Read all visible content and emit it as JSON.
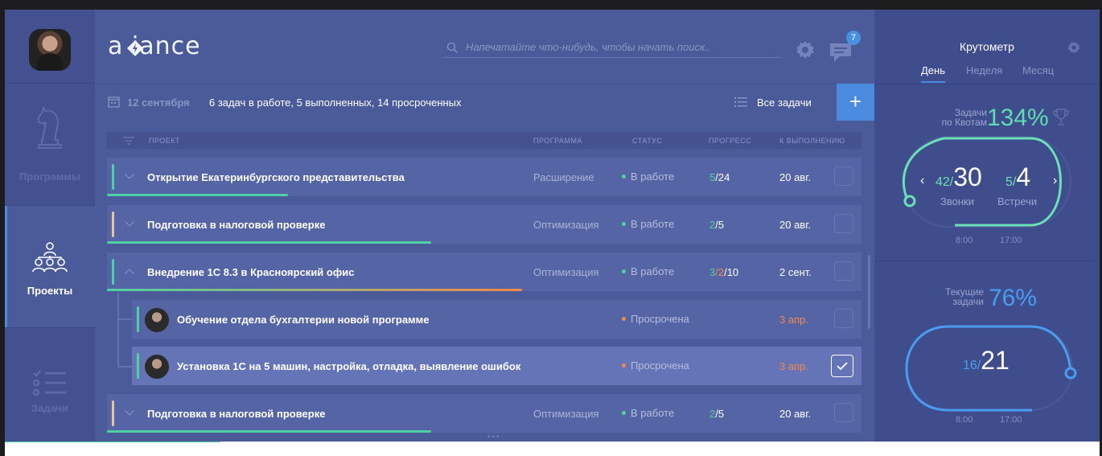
{
  "brand": {
    "logo_text": "a  iance"
  },
  "search": {
    "placeholder": "Напечатайте что-нибудь, чтобы начать поиск.."
  },
  "notifications": {
    "count": "7"
  },
  "sidebar": {
    "items": [
      {
        "label": "Программы",
        "icon": "knight-icon"
      },
      {
        "label": "Проекты",
        "icon": "org-chart-icon"
      },
      {
        "label": "Задачи",
        "icon": "checklist-icon"
      }
    ]
  },
  "subheader": {
    "date": "12 сентября",
    "summary": "6 задач в работе, 5 выполненных, 14 просроченных",
    "filter_label": "Все задачи",
    "add_label": "+"
  },
  "table": {
    "columns": [
      "ПРОЕКТ",
      "ПРОГРАММА",
      "СТАТУС",
      "ПРОГРЕСС",
      "К ВЫПОЛНЕНИЮ"
    ],
    "rows": [
      {
        "title": "Открытие Екатеринбургского представительства",
        "program": "Расширение",
        "status": "В работе",
        "progress_done": "5",
        "progress_mid": "",
        "progress_total": "/24",
        "due": "20 авг.",
        "done_fraction": 0.24,
        "accent": "#4fd1a1"
      },
      {
        "title": "Подготовка в налоговой проверке",
        "program": "Оптимизация",
        "status": "В работе",
        "progress_done": "2",
        "progress_mid": "",
        "progress_total": "/5",
        "due": "20 авг.",
        "done_fraction": 0.43,
        "accent": "#e9c49a"
      },
      {
        "title": "Внедрение 1С 8.3 в Красноярский офис",
        "program": "Оптимизация",
        "status": "В работе",
        "progress_done": "3",
        "progress_mid": "/2",
        "progress_total": "/10",
        "due": "2 сент.",
        "done_fraction": 0.55,
        "accent": "#4fd1a1"
      },
      {
        "title": "Обучение отдела бухгалтерии новой программе",
        "program": "",
        "status": "Просрочена",
        "due": "3 апр."
      },
      {
        "title": "Установка 1С на 5 машин, настройка, отладка, выявление ошибок",
        "program": "",
        "status": "Просрочена",
        "due": "3 апр.",
        "checked": true
      },
      {
        "title": "Подготовка в налоговой проверке",
        "program": "Оптимизация",
        "status": "В работе",
        "progress_done": "2",
        "progress_mid": "",
        "progress_total": "/5",
        "due": "20 авг.",
        "done_fraction": 0.43,
        "accent": "#e9c49a"
      }
    ]
  },
  "krutometr": {
    "title": "Крутометр",
    "tabs": [
      "День",
      "Неделя",
      "Месяц"
    ],
    "active_tab": "День",
    "quota": {
      "label_line1": "Задачи",
      "label_line2": "по Квотам",
      "percent": "134%",
      "calls_done": "42/",
      "calls_target": "30",
      "calls_label": "Звонки",
      "meetings_done": "5/",
      "meetings_target": "4",
      "meetings_label": "Встречи",
      "time_start": "8:00",
      "time_end": "17:00"
    },
    "current": {
      "label_line1": "Текущие",
      "label_line2": "задачи",
      "percent": "76%",
      "done": "16/",
      "total": "21",
      "time_start": "8:00",
      "time_end": "17:00"
    }
  }
}
